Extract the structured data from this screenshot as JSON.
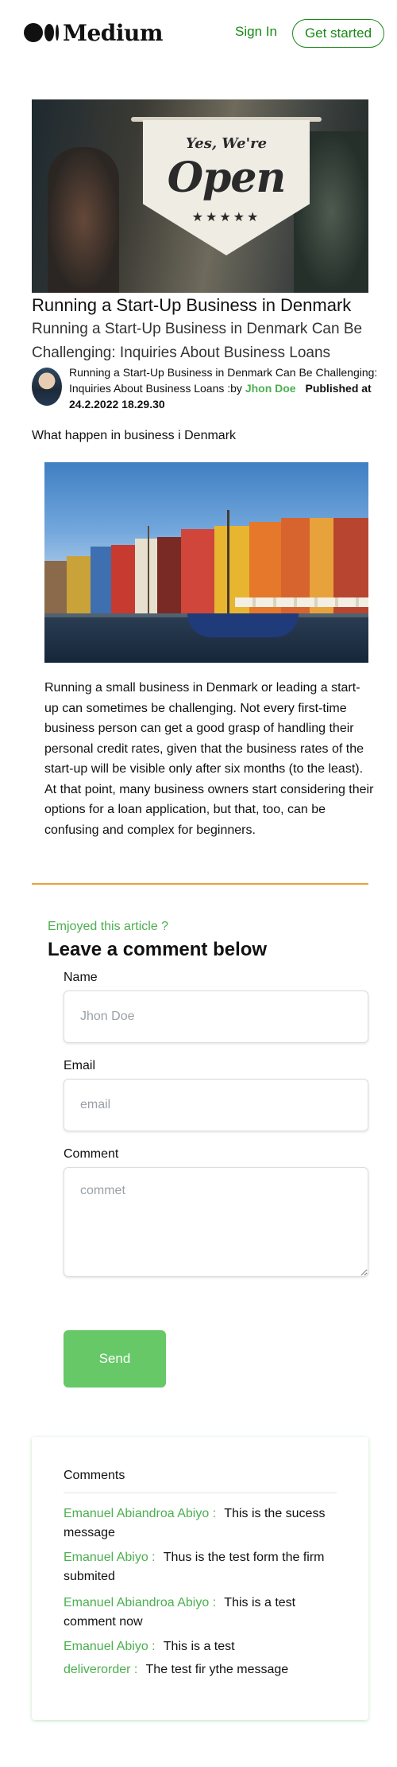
{
  "header": {
    "brand": "Medium",
    "sign_in": "Sign In",
    "get_started": "Get started"
  },
  "hero": {
    "sign_line1": "Yes, We're",
    "sign_line2": "Open",
    "sign_stars": "★★★★★"
  },
  "article": {
    "title": "Running a Start-Up Business in Denmark",
    "subtitle": "Running a Start-Up Business in Denmark Can Be Challenging: Inquiries About Business Loans",
    "byline_text": "Running a Start-Up Business in Denmark Can Be Challenging: Inquiries About Business Loans :by",
    "author": "Jhon Doe",
    "published": "Published at 24.2.2022 18.29.30",
    "lead": "What happen in business i Denmark",
    "body": "Running a small business in Denmark or leading a start-up can sometimes be challenging. Not every first-time business person can get a good grasp of handling their personal credit rates, given that the business rates of the start-up will be visible only after six months (to the least). At that point, many business owners start considering their options for a loan application, but that, too, can be confusing and complex for beginners."
  },
  "comment_form": {
    "enjoyed": "Emjoyed this article ?",
    "title": "Leave a comment below",
    "name_label": "Name",
    "name_placeholder": "Jhon Doe",
    "email_label": "Email",
    "email_placeholder": "email",
    "comment_label": "Comment",
    "comment_placeholder": "commet",
    "send": "Send"
  },
  "comments": {
    "heading": "Comments",
    "items": [
      {
        "author": "Emanuel Abiandroa Abiyo :",
        "text": "This is the sucess message"
      },
      {
        "author": "Emanuel Abiyo :",
        "text": "Thus is the test form the firm submited"
      },
      {
        "author": "Emanuel Abiandroa Abiyo :",
        "text": "This is a test comment now"
      },
      {
        "author": "Emanuel Abiyo :",
        "text": "This is a test"
      },
      {
        "author": "deliverorder :",
        "text": "The test fir ythe message"
      }
    ]
  },
  "colors": {
    "brand_green": "#1a8917",
    "accent_green": "#4caf50",
    "button_green": "#66c866",
    "divider_orange": "#f0a030"
  }
}
